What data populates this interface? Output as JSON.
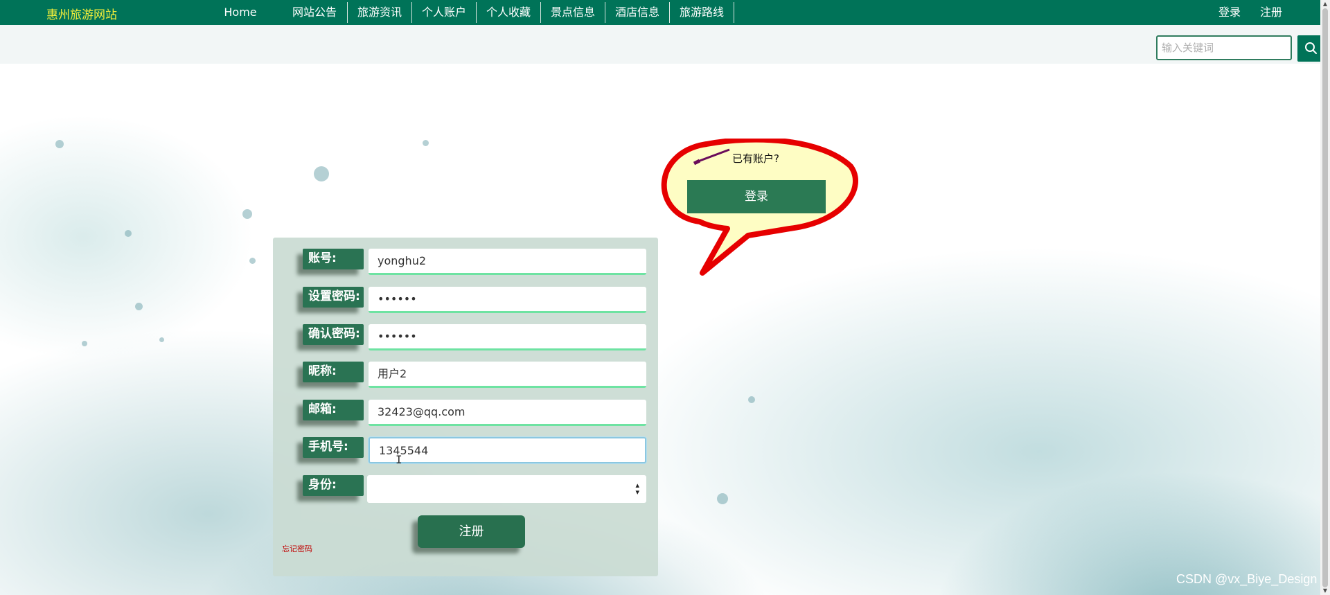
{
  "nav": {
    "brand": "惠州旅游网站",
    "items": [
      "Home",
      "网站公告",
      "旅游资讯",
      "个人账户",
      "个人收藏",
      "景点信息",
      "酒店信息",
      "旅游路线"
    ],
    "login": "登录",
    "register": "注册"
  },
  "search": {
    "placeholder": "输入关键词",
    "icon": "search-icon"
  },
  "bubble": {
    "text": "已有账户?",
    "button": "登录"
  },
  "form": {
    "fields": [
      {
        "label": "账号:",
        "value": "yonghu2"
      },
      {
        "label": "设置密码:",
        "value": "••••••"
      },
      {
        "label": "确认密码:",
        "value": "••••••"
      },
      {
        "label": "昵称:",
        "value": "用户2"
      },
      {
        "label": "邮箱:",
        "value": "32423@qq.com"
      },
      {
        "label": "手机号:",
        "value": "1345544"
      }
    ],
    "identity_label": "身份:",
    "identity_value": "",
    "submit": "注册",
    "forgot": "忘记密码"
  },
  "watermark": "CSDN @vx_Biye_Design",
  "colors": {
    "nav_bg": "#007358",
    "brand": "#f2ee3a",
    "accent": "#2a7353",
    "bubble_fill": "#fefdc4",
    "bubble_stroke": "#e60000",
    "field_underline": "#6ee3a2"
  }
}
